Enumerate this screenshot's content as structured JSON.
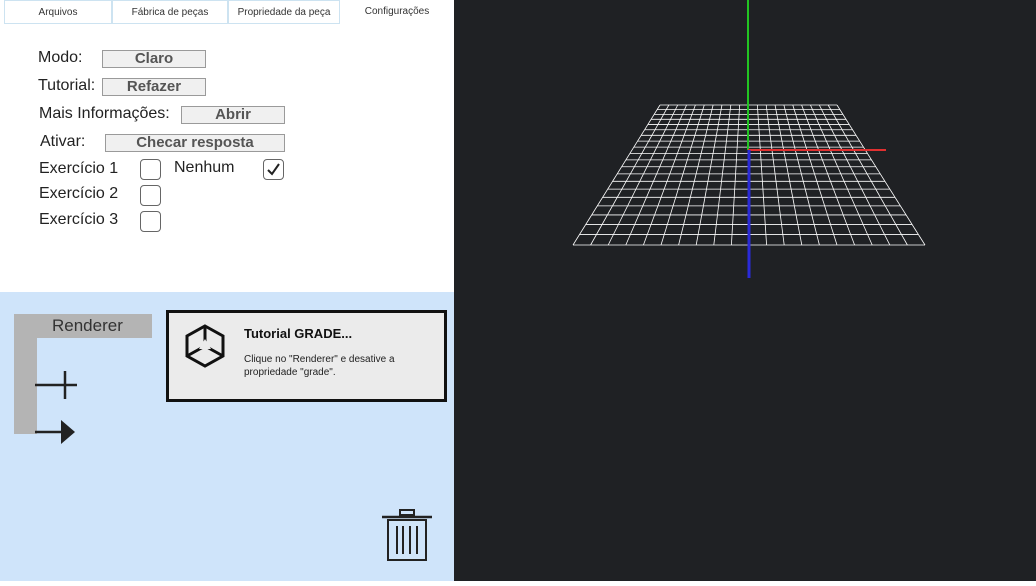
{
  "tabs": [
    "Arquivos",
    "Fábrica de peças",
    "Propriedade da peça",
    "Configurações"
  ],
  "settings": {
    "mode_label": "Modo:",
    "mode_value": "Claro",
    "tutorial_label": "Tutorial:",
    "tutorial_button": "Refazer",
    "info_label": "Mais Informações:",
    "info_button": "Abrir",
    "activate_label": "Ativar:",
    "activate_button": "Checar resposta"
  },
  "exercises": [
    {
      "label": "Exercício 1",
      "checked": false
    },
    {
      "label": "Exercício 2",
      "checked": false
    },
    {
      "label": "Exercício 3",
      "checked": false
    }
  ],
  "none_option": {
    "label": "Nenhum",
    "checked": true
  },
  "renderer": {
    "label": "Renderer"
  },
  "tooltip": {
    "title": "Tutorial GRADE...",
    "body": "Clique no \"Renderer\" e desative a propriedade \"grade\"."
  },
  "icons": {
    "tool_1": "plus-icon",
    "tool_2": "arrow-right-icon",
    "tooltip_logo": "unity-logo-icon",
    "trash": "trash-icon"
  },
  "colors": {
    "viewport_bg": "#1f2124",
    "panel_bg": "#cfe4fa",
    "axis_x": "#e03030",
    "axis_y": "#22c422",
    "axis_z": "#2a2ad8",
    "grid": "#ffffff"
  }
}
